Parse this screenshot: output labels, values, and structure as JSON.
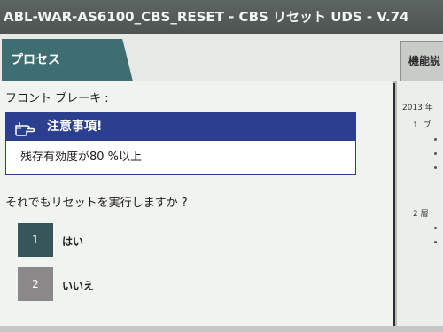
{
  "window": {
    "title": "ABL-WAR-AS6100_CBS_RESET - CBS リセット UDS - V.74"
  },
  "tabs": {
    "process_label": "プロセス",
    "function_label": "機能説"
  },
  "main": {
    "section_title": "フロント ブレーキ :",
    "notice": {
      "icon": "pointing-hand-icon",
      "title": "注意事項!",
      "body": "残存有効度が80 %以上"
    },
    "question": "それでもリセットを実行しますか ?",
    "options": [
      {
        "number": "1",
        "label": "はい"
      },
      {
        "number": "2",
        "label": "いいえ"
      }
    ]
  },
  "right_panel": {
    "year": "2013 年",
    "item1": "1.  ブ",
    "item2": "2    層"
  },
  "colors": {
    "titlebar": "#555c59",
    "tab_active": "#3e6d72",
    "notice_header": "#2b3f8f",
    "option_yes": "#36575a",
    "option_no": "#8a8888",
    "content_bg": "#f1f3f0"
  }
}
